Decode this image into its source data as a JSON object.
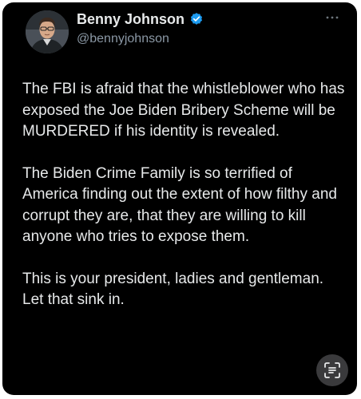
{
  "author": {
    "display_name": "Benny Johnson",
    "handle": "@bennyjohnson",
    "verified": true,
    "avatar_icon": "profile-photo"
  },
  "tweet": {
    "paragraphs": [
      "The FBI is afraid that the whistleblower who has exposed the Joe Biden Bribery Scheme will be MURDERED if his identity is revealed.",
      "The Biden Crime Family is so terrified of America finding out the extent of how filthy and corrupt they are, that they are willing to kill anyone who tries to expose them.",
      "This is your president, ladies and gentleman. Let that sink in."
    ]
  },
  "icons": {
    "more": "more-options-icon",
    "verified": "verified-badge-icon",
    "scan": "live-text-scan-icon"
  },
  "colors": {
    "background": "#000000",
    "text": "#e7e9ea",
    "secondary_text": "#8b98a5",
    "verified_blue": "#1d9bf0"
  }
}
